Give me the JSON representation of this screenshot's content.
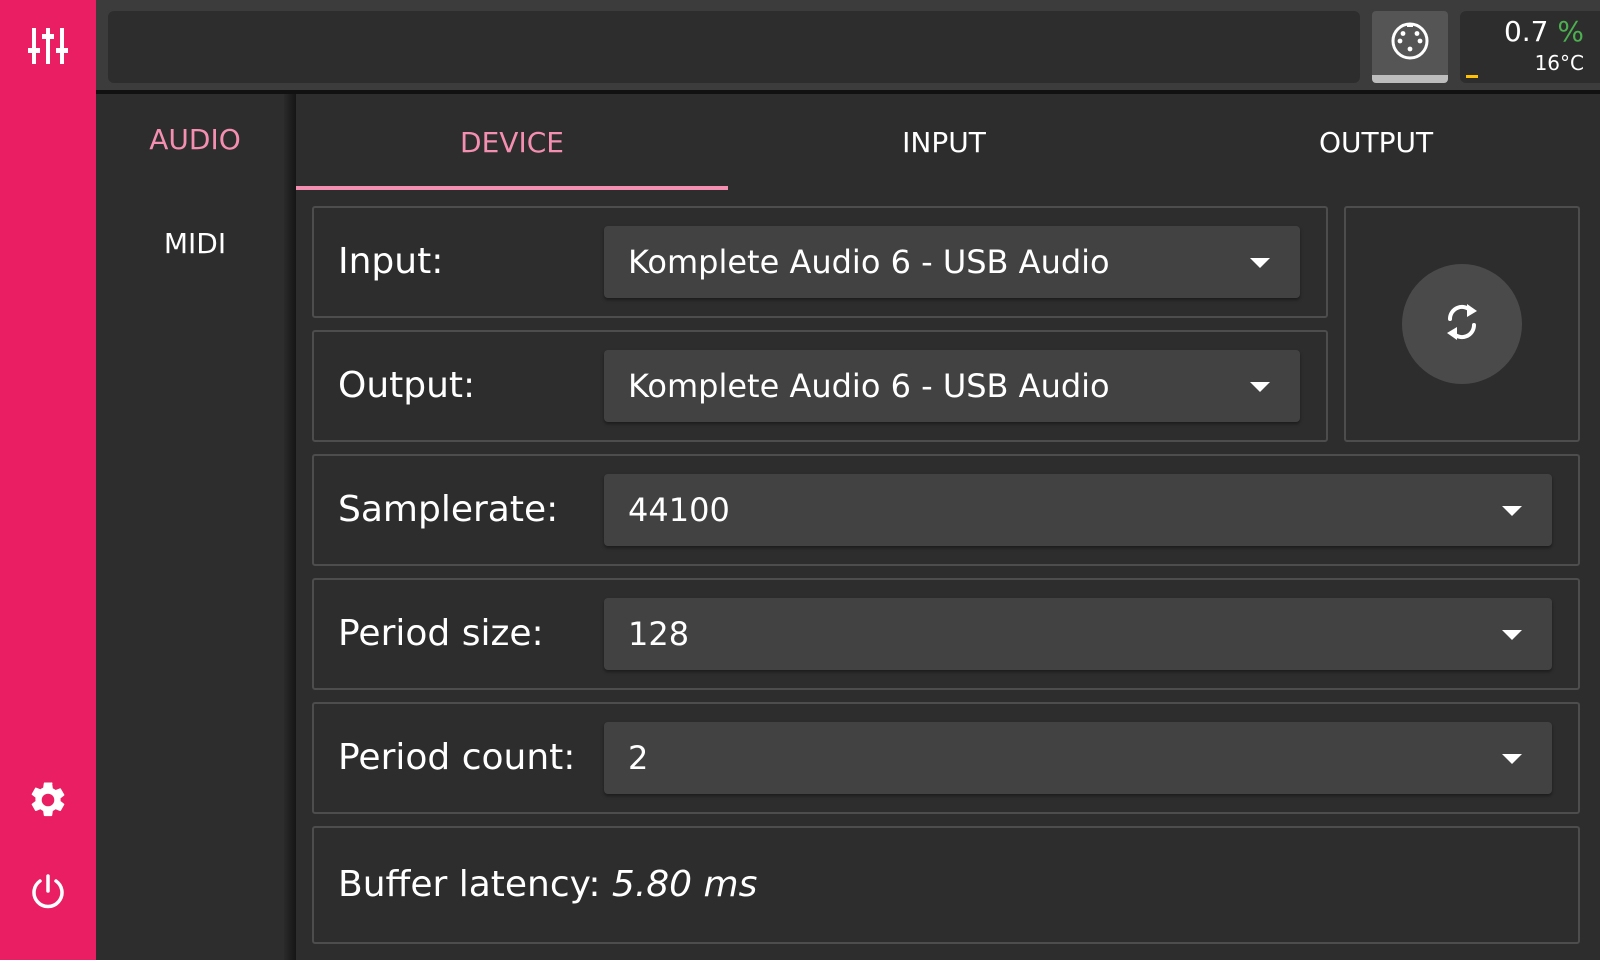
{
  "rail": {
    "top_icon": "mixer-sliders-icon",
    "settings_icon": "gear-icon",
    "power_icon": "power-icon",
    "color": "#e91e63"
  },
  "topbar": {
    "midi_icon": "midi-connector-icon",
    "cpu_value": "0.7",
    "cpu_unit": "%",
    "temperature": "16°C"
  },
  "sidenav": {
    "items": [
      {
        "label": "AUDIO",
        "active": true
      },
      {
        "label": "MIDI",
        "active": false
      }
    ]
  },
  "tabs": [
    {
      "label": "DEVICE",
      "active": true
    },
    {
      "label": "INPUT",
      "active": false
    },
    {
      "label": "OUTPUT",
      "active": false
    }
  ],
  "device": {
    "input": {
      "label": "Input:",
      "value": "Komplete Audio 6 - USB Audio"
    },
    "output": {
      "label": "Output:",
      "value": "Komplete Audio 6 - USB Audio"
    },
    "refresh_icon": "refresh-icon",
    "samplerate": {
      "label": "Samplerate:",
      "value": "44100"
    },
    "period_size": {
      "label": "Period size:",
      "value": "128"
    },
    "period_count": {
      "label": "Period count:",
      "value": "2"
    },
    "latency": {
      "label": "Buffer latency:",
      "value": "5.80 ms"
    }
  },
  "colors": {
    "accent": "#f48fb1",
    "cpu_percent": "#4caf50",
    "cpu_meter": "#ffc107"
  }
}
